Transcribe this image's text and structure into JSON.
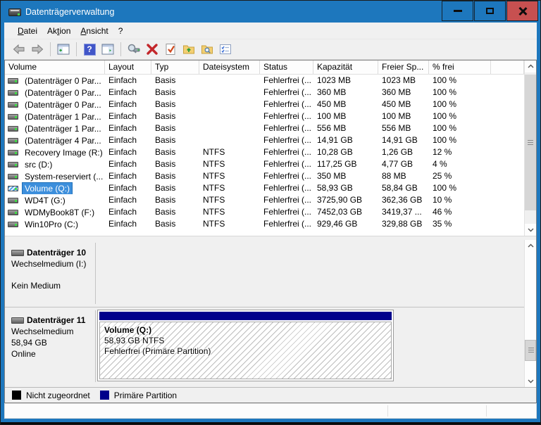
{
  "window": {
    "title": "Datenträgerverwaltung"
  },
  "titlebar_controls": [
    "minimize",
    "maximize",
    "close"
  ],
  "menu": {
    "items": [
      {
        "pre": "",
        "u": "D",
        "post": "atei"
      },
      {
        "pre": "Ak",
        "u": "t",
        "post": "ion"
      },
      {
        "pre": "",
        "u": "A",
        "post": "nsicht"
      },
      {
        "pre": "?",
        "u": "",
        "post": ""
      }
    ]
  },
  "toolbar": {
    "help_glyph": "?",
    "icons": [
      "back",
      "forward",
      "show-console-tree",
      "help",
      "show-action-pane",
      "disk-properties",
      "delete",
      "check-document",
      "folder-up",
      "folder-search",
      "checklist"
    ]
  },
  "table": {
    "columns": [
      "Volume",
      "Layout",
      "Typ",
      "Dateisystem",
      "Status",
      "Kapazität",
      "Freier Sp...",
      "% frei"
    ],
    "rows": [
      {
        "volume": "(Datenträger 0 Par...",
        "layout": "Einfach",
        "typ": "Basis",
        "fs": "",
        "status": "Fehlerfrei (...",
        "kapazitaet": "1023 MB",
        "frei": "1023 MB",
        "pct": "100 %",
        "selected": false
      },
      {
        "volume": "(Datenträger 0 Par...",
        "layout": "Einfach",
        "typ": "Basis",
        "fs": "",
        "status": "Fehlerfrei (...",
        "kapazitaet": "360 MB",
        "frei": "360 MB",
        "pct": "100 %",
        "selected": false
      },
      {
        "volume": "(Datenträger 0 Par...",
        "layout": "Einfach",
        "typ": "Basis",
        "fs": "",
        "status": "Fehlerfrei (...",
        "kapazitaet": "450 MB",
        "frei": "450 MB",
        "pct": "100 %",
        "selected": false
      },
      {
        "volume": "(Datenträger 1 Par...",
        "layout": "Einfach",
        "typ": "Basis",
        "fs": "",
        "status": "Fehlerfrei (...",
        "kapazitaet": "100 MB",
        "frei": "100 MB",
        "pct": "100 %",
        "selected": false
      },
      {
        "volume": "(Datenträger 1 Par...",
        "layout": "Einfach",
        "typ": "Basis",
        "fs": "",
        "status": "Fehlerfrei (...",
        "kapazitaet": "556 MB",
        "frei": "556 MB",
        "pct": "100 %",
        "selected": false
      },
      {
        "volume": "(Datenträger 4 Par...",
        "layout": "Einfach",
        "typ": "Basis",
        "fs": "",
        "status": "Fehlerfrei (...",
        "kapazitaet": "14,91 GB",
        "frei": "14,91 GB",
        "pct": "100 %",
        "selected": false
      },
      {
        "volume": "Recovery Image (R:)",
        "layout": "Einfach",
        "typ": "Basis",
        "fs": "NTFS",
        "status": "Fehlerfrei (...",
        "kapazitaet": "10,28 GB",
        "frei": "1,26 GB",
        "pct": "12 %",
        "selected": false
      },
      {
        "volume": "src (D:)",
        "layout": "Einfach",
        "typ": "Basis",
        "fs": "NTFS",
        "status": "Fehlerfrei (...",
        "kapazitaet": "117,25 GB",
        "frei": "4,77 GB",
        "pct": "4 %",
        "selected": false
      },
      {
        "volume": "System-reserviert (...",
        "layout": "Einfach",
        "typ": "Basis",
        "fs": "NTFS",
        "status": "Fehlerfrei (...",
        "kapazitaet": "350 MB",
        "frei": "88 MB",
        "pct": "25 %",
        "selected": false
      },
      {
        "volume": "Volume (Q:)",
        "layout": "Einfach",
        "typ": "Basis",
        "fs": "NTFS",
        "status": "Fehlerfrei (...",
        "kapazitaet": "58,93 GB",
        "frei": "58,84 GB",
        "pct": "100 %",
        "selected": true
      },
      {
        "volume": "WD4T (G:)",
        "layout": "Einfach",
        "typ": "Basis",
        "fs": "NTFS",
        "status": "Fehlerfrei (...",
        "kapazitaet": "3725,90 GB",
        "frei": "362,36 GB",
        "pct": "10 %",
        "selected": false
      },
      {
        "volume": "WDMyBook8T (F:)",
        "layout": "Einfach",
        "typ": "Basis",
        "fs": "NTFS",
        "status": "Fehlerfrei (...",
        "kapazitaet": "7452,03 GB",
        "frei": "3419,37 ...",
        "pct": "46 %",
        "selected": false
      },
      {
        "volume": "Win10Pro (C:)",
        "layout": "Einfach",
        "typ": "Basis",
        "fs": "NTFS",
        "status": "Fehlerfrei (...",
        "kapazitaet": "929,46 GB",
        "frei": "329,88 GB",
        "pct": "35 %",
        "selected": false
      }
    ]
  },
  "disks": [
    {
      "name": "Datenträger 10",
      "media": "Wechselmedium (I:)",
      "size": "",
      "status": "Kein Medium"
    },
    {
      "name": "Datenträger 11",
      "media": "Wechselmedium",
      "size": "58,94 GB",
      "status": "Online",
      "partition": {
        "label": "Volume  (Q:)",
        "size_fs": "58,93 GB NTFS",
        "status": "Fehlerfrei (Primäre Partition)"
      }
    }
  ],
  "legend": {
    "items": [
      {
        "label": "Nicht zugeordnet",
        "color": "#000000"
      },
      {
        "label": "Primäre Partition",
        "color": "#00008b"
      }
    ]
  },
  "colors": {
    "titlebar": "#1d77bd",
    "close_button": "#c75050",
    "selection": "#3d8fdc",
    "primary_partition": "#00008b"
  }
}
